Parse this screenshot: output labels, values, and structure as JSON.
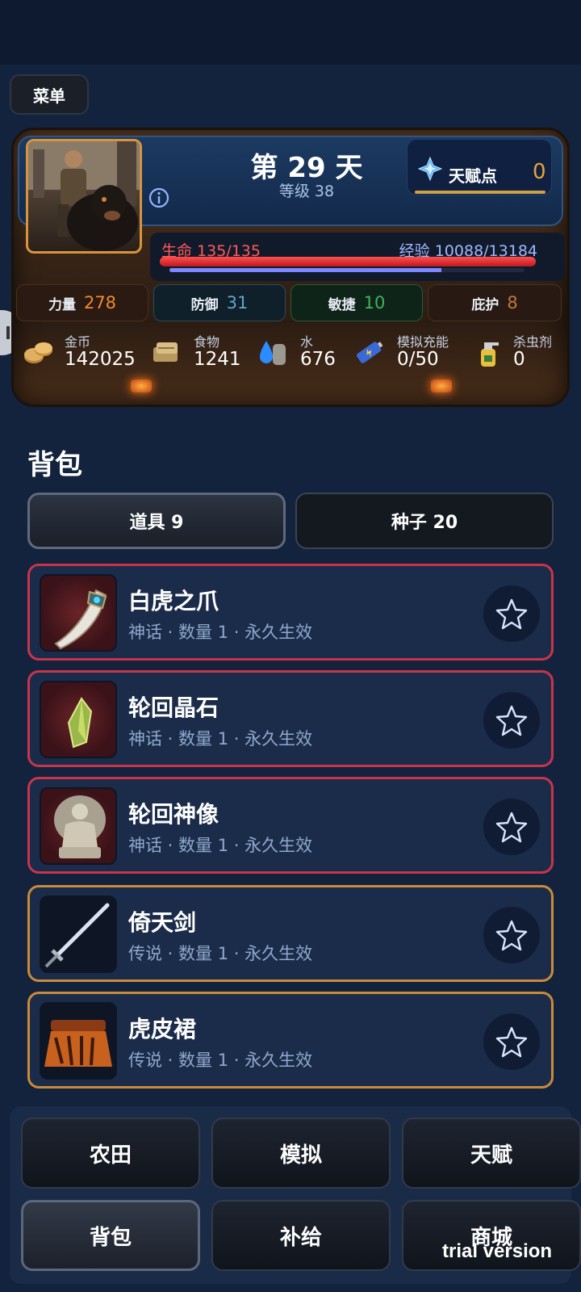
{
  "menu": {
    "label": "菜单"
  },
  "status": {
    "day_title": "第 29 天",
    "level": "等级 38",
    "talent": {
      "label": "天赋点",
      "value": "0"
    },
    "hp": {
      "label": "生命 135/135",
      "fraction": 1.0
    },
    "exp": {
      "label": "经验 10088/13184",
      "fraction": 0.765
    },
    "attributes": [
      {
        "label": "力量",
        "value": "278",
        "color": "#f08a2e"
      },
      {
        "label": "防御",
        "value": "31",
        "color": "#5da8c8"
      },
      {
        "label": "敏捷",
        "value": "10",
        "color": "#3fb35a"
      },
      {
        "label": "庇护",
        "value": "8",
        "color": "#c07a38"
      }
    ],
    "resources": [
      {
        "label": "金币",
        "value": "142025",
        "icon": "coins-icon"
      },
      {
        "label": "食物",
        "value": "1241",
        "icon": "food-icon"
      },
      {
        "label": "水",
        "value": "676",
        "icon": "water-icon"
      },
      {
        "label": "模拟充能",
        "value": "0/50",
        "icon": "battery-icon"
      },
      {
        "label": "杀虫剂",
        "value": "0",
        "icon": "spray-icon"
      }
    ]
  },
  "backpack": {
    "title": "背包",
    "tabs": [
      {
        "label": "道具 9"
      },
      {
        "label": "种子 20"
      }
    ],
    "items": [
      {
        "name": "白虎之爪",
        "meta": "神话 · 数量 1 · 永久生效",
        "icon": "claw-icon"
      },
      {
        "name": "轮回晶石",
        "meta": "神话 · 数量 1 · 永久生效",
        "icon": "crystal-icon"
      },
      {
        "name": "轮回神像",
        "meta": "神话 · 数量 1 · 永久生效",
        "icon": "statue-icon"
      },
      {
        "name": "倚天剑",
        "meta": "传说 · 数量 1 · 永久生效",
        "icon": "sword-icon"
      },
      {
        "name": "虎皮裙",
        "meta": "传说 · 数量 1 · 永久生效",
        "icon": "skirt-icon"
      }
    ]
  },
  "nav": {
    "buttons": [
      {
        "label": "农田"
      },
      {
        "label": "模拟"
      },
      {
        "label": "天赋"
      },
      {
        "label": "背包"
      },
      {
        "label": "补给"
      },
      {
        "label": "商城"
      }
    ]
  },
  "watermark": "trial version"
}
